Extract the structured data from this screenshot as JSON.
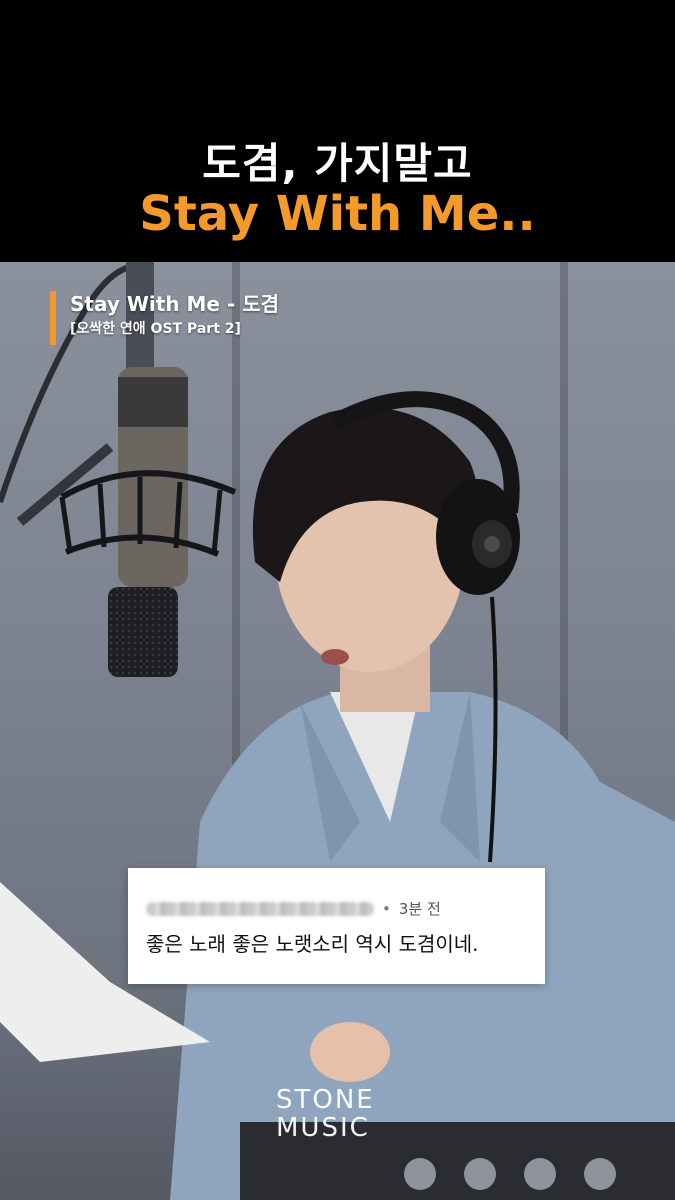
{
  "header": {
    "title_line_1": "도겸, 가지말고",
    "title_line_2": "Stay With Me..",
    "accent_color": "#F39A2B"
  },
  "song": {
    "title": "Stay With Me - 도겸",
    "subtitle": "[오싹한 연애 OST Part 2]"
  },
  "comment": {
    "dot": "•",
    "time": "3분 전",
    "text": "좋은 노래 좋은 노랫소리 역시 도겸이네."
  },
  "watermark": {
    "line_1": "STONE",
    "line_2": "MUSIC"
  },
  "icons": [
    "microphone",
    "headphones"
  ]
}
